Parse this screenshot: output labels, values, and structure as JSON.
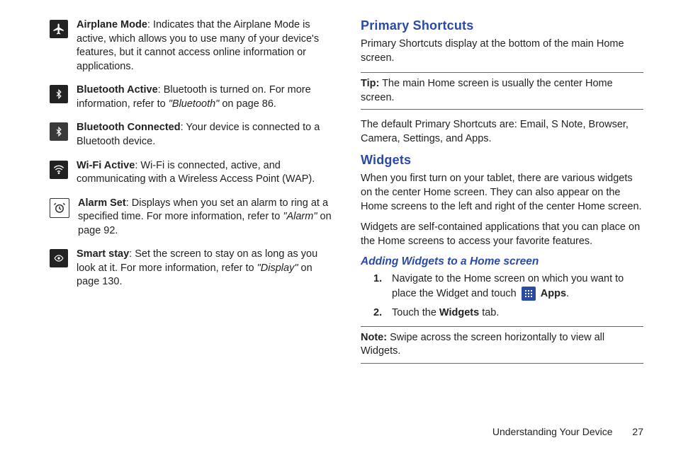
{
  "left": {
    "items": [
      {
        "icon": "airplane-icon",
        "name": "Airplane Mode",
        "desc": ": Indicates that the Airplane Mode is active, which allows you to use many of your device's features, but it cannot access online information or applications."
      },
      {
        "icon": "bluetooth-icon",
        "name": "Bluetooth Active",
        "desc_pre": ": Bluetooth is turned on. For more information, refer to ",
        "ref": "\"Bluetooth\"",
        "desc_post": " on page 86."
      },
      {
        "icon": "bluetooth-connected-icon",
        "name": "Bluetooth Connected",
        "desc": ": Your device is connected to a Bluetooth device."
      },
      {
        "icon": "wifi-icon",
        "name": "Wi-Fi Active",
        "desc": ": Wi-Fi is connected, active, and communicating with a Wireless Access Point (WAP)."
      },
      {
        "icon": "alarm-icon",
        "name": "Alarm Set",
        "desc_pre": ": Displays when you set an alarm to ring at a specified time. For more information, refer to ",
        "ref": "\"Alarm\"",
        "desc_post": " on page 92."
      },
      {
        "icon": "smart-stay-icon",
        "name": "Smart stay",
        "desc_pre": ": Set the screen to stay on as long as you look at it. For more information, refer to ",
        "ref": "\"Display\"",
        "desc_post": " on page 130."
      }
    ]
  },
  "right": {
    "h_primary": "Primary Shortcuts",
    "p_primary": "Primary Shortcuts display at the bottom of the main Home screen.",
    "tip_label": "Tip:",
    "tip_text": " The main Home screen is usually the center Home screen.",
    "p_defaults": "The default Primary Shortcuts are: Email, S Note, Browser, Camera, Settings, and Apps.",
    "h_widgets": "Widgets",
    "p_w1": "When you first turn on your tablet, there are various widgets on the center Home screen. They can also appear on the Home screens to the left and right of the center Home screen.",
    "p_w2": "Widgets are self-contained applications that you can place on the Home screens to access your favorite features.",
    "h_adding": "Adding Widgets to a Home screen",
    "step1_num": "1.",
    "step1_pre": "Navigate to the Home screen on which you want to place the Widget and touch ",
    "step1_apps": "Apps",
    "step1_post": ".",
    "step2_num": "2.",
    "step2_pre": "Touch the ",
    "step2_widgets": "Widgets",
    "step2_post": " tab.",
    "note_label": "Note:",
    "note_text": " Swipe across the screen horizontally to view all Widgets."
  },
  "footer": {
    "section": "Understanding Your Device",
    "page": "27"
  }
}
